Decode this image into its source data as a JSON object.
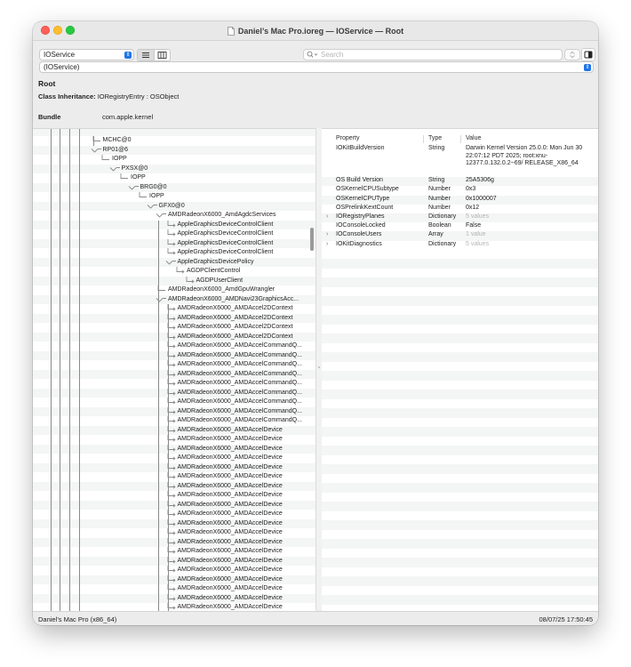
{
  "window": {
    "title": "Daniel’s Mac Pro.ioreg — IOService — Root"
  },
  "toolbar": {
    "plane_select": "IOService",
    "search_placeholder": "Search",
    "plane_path": "(IOService)"
  },
  "info": {
    "name": "Root",
    "class_inheritance_label": "Class Inheritance:",
    "class_inheritance_value": "IORegistryEntry : OSObject",
    "bundle_label": "Bundle",
    "bundle_value": "com.apple.kernel"
  },
  "tree": [
    {
      "label": "MCHC@0",
      "depth": 1
    },
    {
      "label": "RP01@6",
      "depth": 1,
      "expanded": true
    },
    {
      "label": "IOPP",
      "depth": 2
    },
    {
      "label": "PXSX@0",
      "depth": 3,
      "expanded": true
    },
    {
      "label": "IOPP",
      "depth": 4
    },
    {
      "label": "BRG0@0",
      "depth": 5,
      "expanded": true
    },
    {
      "label": "IOPP",
      "depth": 6
    },
    {
      "label": "GFX0@0",
      "depth": 7,
      "expanded": true
    },
    {
      "label": "AMDRadeonX6000_AmdAgdcServices",
      "depth": 8,
      "expanded": true
    },
    {
      "label": "AppleGraphicsDeviceControlClient",
      "depth": 9
    },
    {
      "label": "AppleGraphicsDeviceControlClient",
      "depth": 9
    },
    {
      "label": "AppleGraphicsDeviceControlClient",
      "depth": 9
    },
    {
      "label": "AppleGraphicsDeviceControlClient",
      "depth": 9
    },
    {
      "label": "AppleGraphicsDevicePolicy",
      "depth": 9,
      "expanded": true
    },
    {
      "label": "AGDPClientControl",
      "depth": 10
    },
    {
      "label": "AGDPUserClient",
      "depth": 11
    },
    {
      "label": "AMDRadeonX6000_AmdGpuWrangler",
      "depth": 8
    },
    {
      "label": "AMDRadeonX6000_AMDNavi23GraphicsAcc...",
      "depth": 8,
      "expanded": true
    },
    {
      "label": "AMDRadeonX6000_AMDAccel2DContext",
      "depth": 9
    },
    {
      "label": "AMDRadeonX6000_AMDAccel2DContext",
      "depth": 9
    },
    {
      "label": "AMDRadeonX6000_AMDAccel2DContext",
      "depth": 9
    },
    {
      "label": "AMDRadeonX6000_AMDAccel2DContext",
      "depth": 9
    },
    {
      "label": "AMDRadeonX6000_AMDAccelCommandQ...",
      "depth": 9
    },
    {
      "label": "AMDRadeonX6000_AMDAccelCommandQ...",
      "depth": 9
    },
    {
      "label": "AMDRadeonX6000_AMDAccelCommandQ...",
      "depth": 9
    },
    {
      "label": "AMDRadeonX6000_AMDAccelCommandQ...",
      "depth": 9
    },
    {
      "label": "AMDRadeonX6000_AMDAccelCommandQ...",
      "depth": 9
    },
    {
      "label": "AMDRadeonX6000_AMDAccelCommandQ...",
      "depth": 9
    },
    {
      "label": "AMDRadeonX6000_AMDAccelCommandQ...",
      "depth": 9
    },
    {
      "label": "AMDRadeonX6000_AMDAccelCommandQ...",
      "depth": 9
    },
    {
      "label": "AMDRadeonX6000_AMDAccelCommandQ...",
      "depth": 9
    },
    {
      "label": "AMDRadeonX6000_AMDAccelDevice",
      "depth": 9
    },
    {
      "label": "AMDRadeonX6000_AMDAccelDevice",
      "depth": 9
    },
    {
      "label": "AMDRadeonX6000_AMDAccelDevice",
      "depth": 9
    },
    {
      "label": "AMDRadeonX6000_AMDAccelDevice",
      "depth": 9
    },
    {
      "label": "AMDRadeonX6000_AMDAccelDevice",
      "depth": 9
    },
    {
      "label": "AMDRadeonX6000_AMDAccelDevice",
      "depth": 9
    },
    {
      "label": "AMDRadeonX6000_AMDAccelDevice",
      "depth": 9
    },
    {
      "label": "AMDRadeonX6000_AMDAccelDevice",
      "depth": 9
    },
    {
      "label": "AMDRadeonX6000_AMDAccelDevice",
      "depth": 9
    },
    {
      "label": "AMDRadeonX6000_AMDAccelDevice",
      "depth": 9
    },
    {
      "label": "AMDRadeonX6000_AMDAccelDevice",
      "depth": 9
    },
    {
      "label": "AMDRadeonX6000_AMDAccelDevice",
      "depth": 9
    },
    {
      "label": "AMDRadeonX6000_AMDAccelDevice",
      "depth": 9
    },
    {
      "label": "AMDRadeonX6000_AMDAccelDevice",
      "depth": 9
    },
    {
      "label": "AMDRadeonX6000_AMDAccelDevice",
      "depth": 9
    },
    {
      "label": "AMDRadeonX6000_AMDAccelDevice",
      "depth": 9
    },
    {
      "label": "AMDRadeonX6000_AMDAccelDevice",
      "depth": 9
    },
    {
      "label": "AMDRadeonX6000_AMDAccelDevice",
      "depth": 9
    },
    {
      "label": "AMDRadeonX6000_AMDAccelDevice",
      "depth": 9
    },
    {
      "label": "AMDRadeonX6000_AMDAccelDevice",
      "depth": 9
    }
  ],
  "properties": {
    "headers": {
      "property": "Property",
      "type": "Type",
      "value": "Value"
    },
    "rows": [
      {
        "property": "IOKitBuildVersion",
        "type": "String",
        "value": "Darwin Kernel Version 25.0.0: Mon Jun 30 22:07:12 PDT 2025; root:xnu-12377.0.132.0.2~69/ RELEASE_X86_64",
        "lines": 4,
        "disclosure": false,
        "muted": false
      },
      {
        "property": "OS Build Version",
        "type": "String",
        "value": "25A5306g",
        "lines": 1,
        "disclosure": false,
        "muted": false
      },
      {
        "property": "OSKernelCPUSubtype",
        "type": "Number",
        "value": "0x3",
        "lines": 1,
        "disclosure": false,
        "muted": false
      },
      {
        "property": "OSKernelCPUType",
        "type": "Number",
        "value": "0x1000007",
        "lines": 1,
        "disclosure": false,
        "muted": false
      },
      {
        "property": "OSPrelinkKextCount",
        "type": "Number",
        "value": "0x12",
        "lines": 1,
        "disclosure": false,
        "muted": false
      },
      {
        "property": "IORegistryPlanes",
        "type": "Dictionary",
        "value": "5 values",
        "lines": 1,
        "disclosure": true,
        "muted": true
      },
      {
        "property": "IOConsoleLocked",
        "type": "Boolean",
        "value": "False",
        "lines": 1,
        "disclosure": false,
        "muted": false
      },
      {
        "property": "IOConsoleUsers",
        "type": "Array",
        "value": "1 value",
        "lines": 1,
        "disclosure": true,
        "muted": true
      },
      {
        "property": "IOKitDiagnostics",
        "type": "Dictionary",
        "value": "5 values",
        "lines": 1,
        "disclosure": true,
        "muted": true
      }
    ]
  },
  "status": {
    "machine": "Daniel’s Mac Pro (x86_64)",
    "timestamp": "08/07/25 17:50:45"
  },
  "colors": {
    "accent": "#1f74e8",
    "close": "#fe5f57",
    "minimize": "#febc2e",
    "zoom": "#28c840",
    "tree_line": "#8a8a8a",
    "muted_text": "#b4b4b4"
  },
  "icons": [
    "document-icon",
    "chevron-updown-icon",
    "list-view-icon",
    "column-view-icon",
    "search-icon",
    "stepper-icon",
    "sidebar-toggle-icon",
    "disclosure-chevron-icon"
  ]
}
